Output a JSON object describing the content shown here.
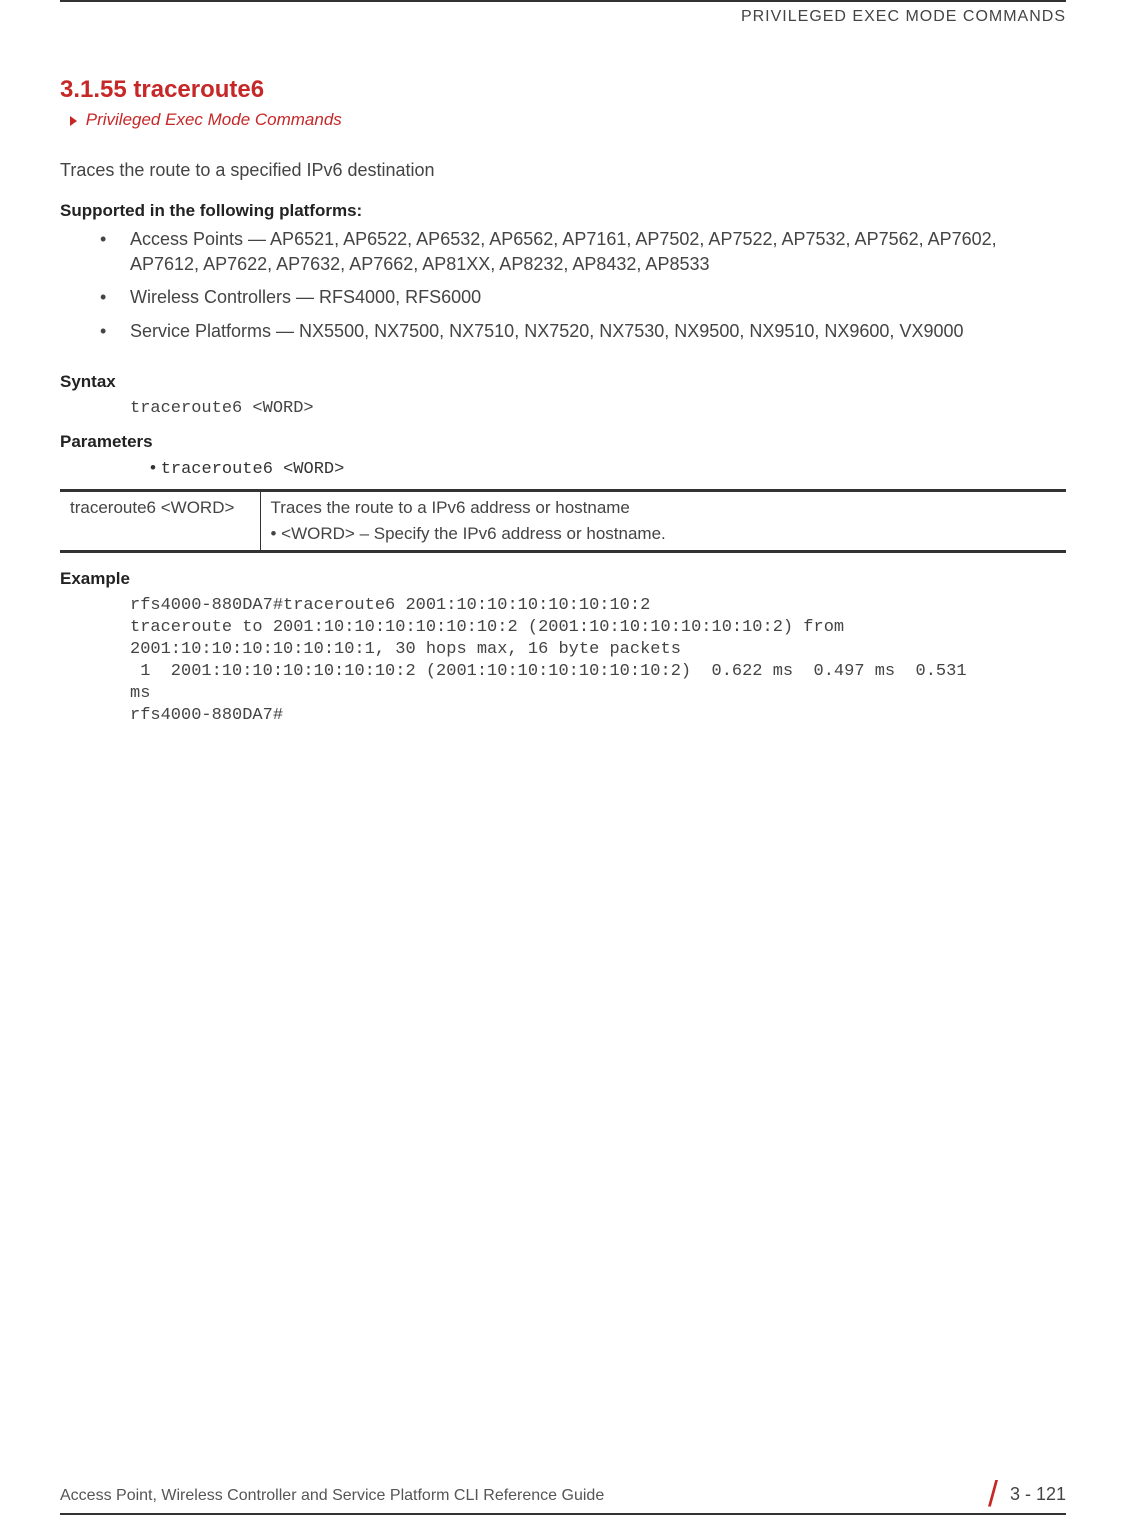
{
  "header": {
    "chapter_title": "PRIVILEGED EXEC MODE COMMANDS"
  },
  "section": {
    "number_title": "3.1.55 traceroute6",
    "breadcrumb": "Privileged Exec Mode Commands",
    "description": "Traces the route to a specified IPv6 destination"
  },
  "supported": {
    "heading": "Supported in the following platforms:",
    "items": [
      "Access Points — AP6521, AP6522, AP6532, AP6562, AP7161, AP7502, AP7522, AP7532, AP7562, AP7602, AP7612, AP7622, AP7632, AP7662, AP81XX, AP8232, AP8432, AP8533",
      "Wireless Controllers — RFS4000, RFS6000",
      "Service Platforms — NX5500, NX7500, NX7510, NX7520, NX7530, NX9500, NX9510, NX9600, VX9000"
    ]
  },
  "syntax": {
    "heading": "Syntax",
    "code": "traceroute6 <WORD>"
  },
  "parameters": {
    "heading": "Parameters",
    "bullet": "• ",
    "bullet_code": "traceroute6 <WORD>",
    "table": {
      "col1": "traceroute6 <WORD>",
      "col2_line1": "Traces the route to a IPv6 address or hostname",
      "col2_line2": "•  <WORD> – Specify the IPv6 address or hostname."
    }
  },
  "example": {
    "heading": "Example",
    "code": "rfs4000-880DA7#traceroute6 2001:10:10:10:10:10:10:2\ntraceroute to 2001:10:10:10:10:10:10:2 (2001:10:10:10:10:10:10:2) from \n2001:10:10:10:10:10:10:1, 30 hops max, 16 byte packets\n 1  2001:10:10:10:10:10:10:2 (2001:10:10:10:10:10:10:2)  0.622 ms  0.497 ms  0.531 \nms\nrfs4000-880DA7#"
  },
  "footer": {
    "left": "Access Point, Wireless Controller and Service Platform CLI Reference Guide",
    "page": "3 - 121"
  }
}
